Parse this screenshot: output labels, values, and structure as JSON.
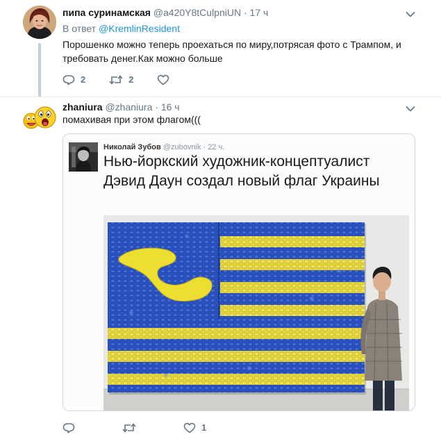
{
  "tweet1": {
    "name": "пипа суринамская",
    "handle": "@a420Y8tCulpniUN",
    "dot": "·",
    "time": "17 ч",
    "reply_prefix": "В ответ",
    "reply_to": "@KremlinResident",
    "text": "Порошенко можно теперь проехаться по миру,потрясая фото с Трампом, и требовать денег.Как можно больше",
    "reply_count": "2",
    "retweet_count": "2"
  },
  "tweet2": {
    "name": "zhaniura",
    "handle": "@zhaniura",
    "dot": "·",
    "time": "16 ч",
    "text": "помахивая при этом флагом(((",
    "like_count": "1",
    "quoted": {
      "name": "Николай Зубов",
      "handle": "@zubovnik",
      "dot": "·",
      "time": "22 ч.",
      "text": "Нью-йоркский художник-концептуалист Дэвид Даун создал новый флаг Украины"
    }
  },
  "colors": {
    "accent": "#1b95e0",
    "muted": "#657786",
    "flag_blue": "#2a4fbf",
    "flag_yellow": "#e8dc3a"
  },
  "icons": [
    "chevron-down-icon",
    "reply-icon",
    "retweet-icon",
    "like-icon"
  ]
}
